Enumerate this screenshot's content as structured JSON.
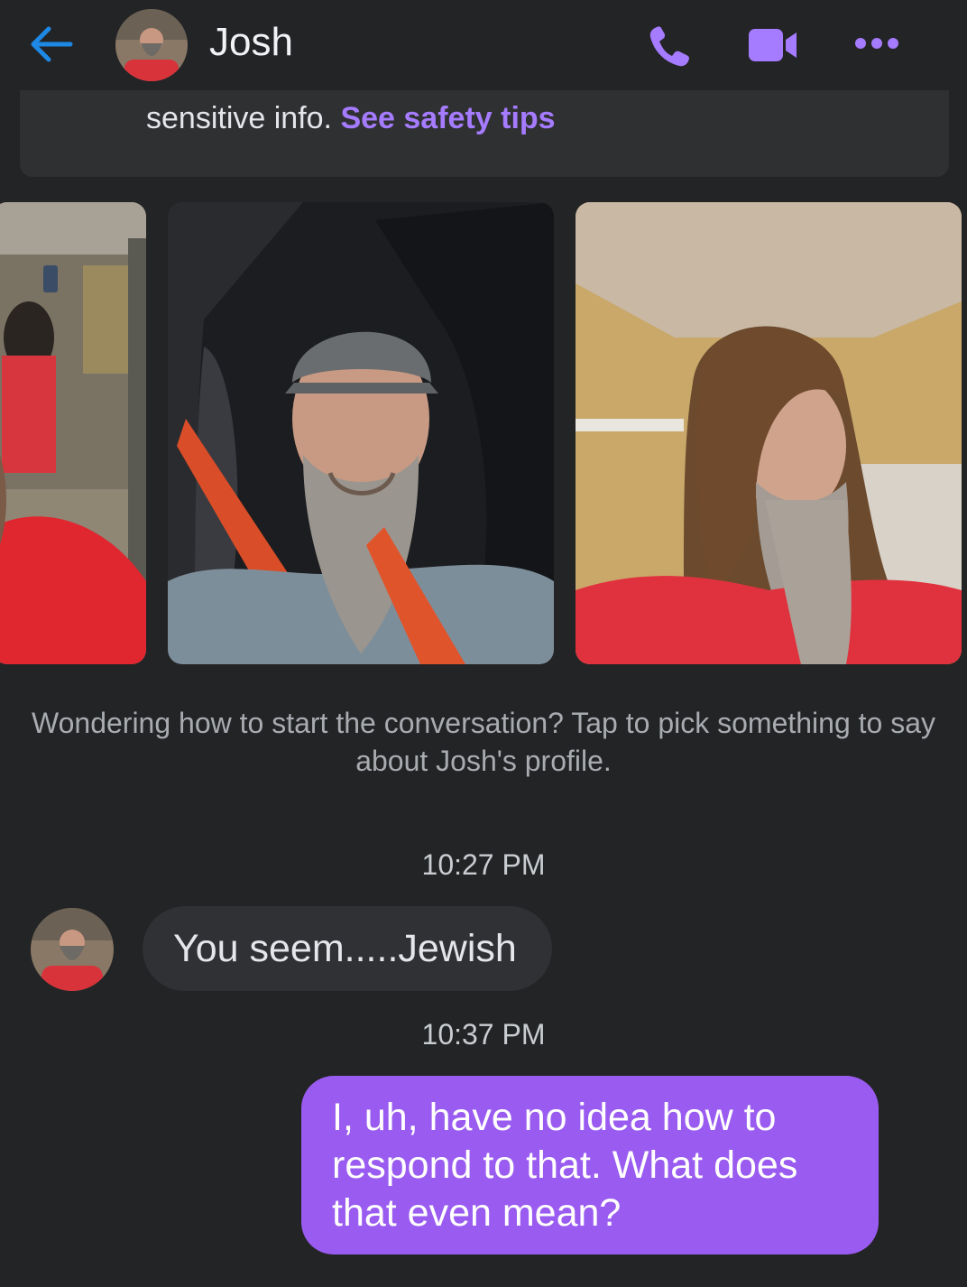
{
  "header": {
    "contact_name": "Josh",
    "icons": [
      "back-arrow-icon",
      "phone-icon",
      "video-camera-icon",
      "more-options-icon"
    ],
    "accent_color": "#a57bff",
    "back_color": "#1e88e5"
  },
  "notice": {
    "text": "sensitive info. ",
    "link": "See safety tips"
  },
  "profile": {
    "prompt": "Wondering how to start the conversation? Tap to pick something to say about Josh's profile."
  },
  "messages": [
    {
      "time": "10:27 PM",
      "sender": "Josh",
      "text": "You seem.....Jewish"
    },
    {
      "time": "10:37 PM",
      "sender": "me",
      "text": "I, uh, have no idea how to respond to that. What does that even mean?"
    }
  ]
}
